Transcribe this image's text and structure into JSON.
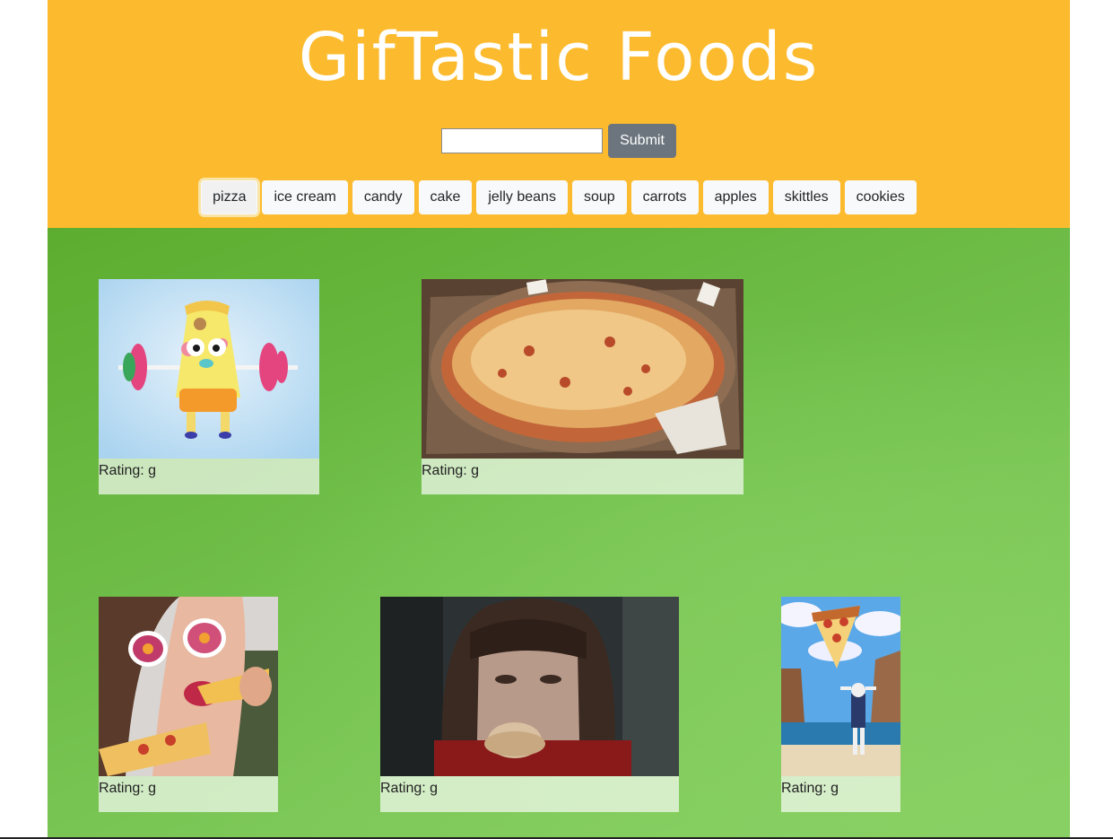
{
  "header": {
    "title": "GifTastic Foods",
    "search_value": "",
    "submit_label": "Submit"
  },
  "topics": [
    "pizza",
    "ice cream",
    "candy",
    "cake",
    "jelly beans",
    "soup",
    "carrots",
    "apples",
    "skittles",
    "cookies"
  ],
  "active_topic": "pizza",
  "gifs": [
    {
      "rating_label": "Rating: g"
    },
    {
      "rating_label": "Rating: g"
    },
    {
      "rating_label": "Rating: g"
    },
    {
      "rating_label": "Rating: g"
    },
    {
      "rating_label": "Rating: g"
    }
  ],
  "colors": {
    "header_bg": "#fcbb2e",
    "gallery_bg": "#6cbb45",
    "submit_bg": "#6c757d",
    "topic_btn_bg": "#f8f9fa"
  }
}
